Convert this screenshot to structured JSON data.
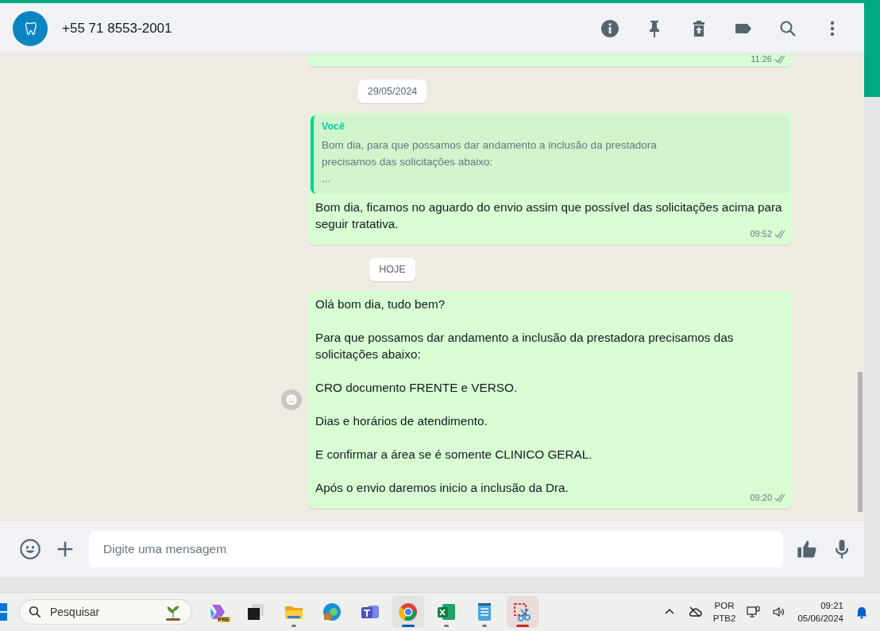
{
  "header": {
    "contact": "+55 71 8553-2001"
  },
  "messages": [
    {
      "kind": "message",
      "time": "11:26",
      "read": false,
      "cut": true
    },
    {
      "kind": "date",
      "text": "29/05/2024"
    },
    {
      "kind": "message",
      "quote": {
        "author": "Você",
        "text": "Bom dia, para que possamos dar andamento a inclusão da prestadora\nprecisamos das solicitações abaixo:\n..."
      },
      "text": "Bom dia, ficamos no aguardo do envio assim que possível das solicitações acima para seguir tratativa.",
      "time": "09:52",
      "read": false
    },
    {
      "kind": "date",
      "text": "HOJE"
    },
    {
      "kind": "message",
      "text": "Olá bom dia, tudo bem?\n\nPara que possamos dar andamento a inclusão da prestadora precisamos das solicitações abaixo:\n\nCRO documento FRENTE e VERSO.\n\nDias e horários de atendimento.\n\nE confirmar a área se é somente CLINICO GERAL.\n\nApós o envio daremos inicio a inclusão da Dra.",
      "time": "09:20",
      "read": false,
      "react_button": true
    }
  ],
  "composer": {
    "placeholder": "Digite uma mensagem"
  },
  "taskbar": {
    "search": {
      "placeholder": "Pesquisar"
    },
    "apps": [
      {
        "badge": "PRE",
        "running": false,
        "active": false
      },
      {
        "running": false,
        "active": false
      },
      {
        "running": true,
        "active": false
      },
      {
        "running": false,
        "active": false
      },
      {
        "running": false,
        "active": false
      },
      {
        "running": true,
        "active": true
      },
      {
        "running": true,
        "active": false
      },
      {
        "running": true,
        "active": false
      },
      {
        "running": true,
        "active": true,
        "color": "#c42b1c"
      }
    ],
    "language": "POR",
    "layout": "PTB2",
    "time": "09:21",
    "date": "05/06/2024"
  }
}
